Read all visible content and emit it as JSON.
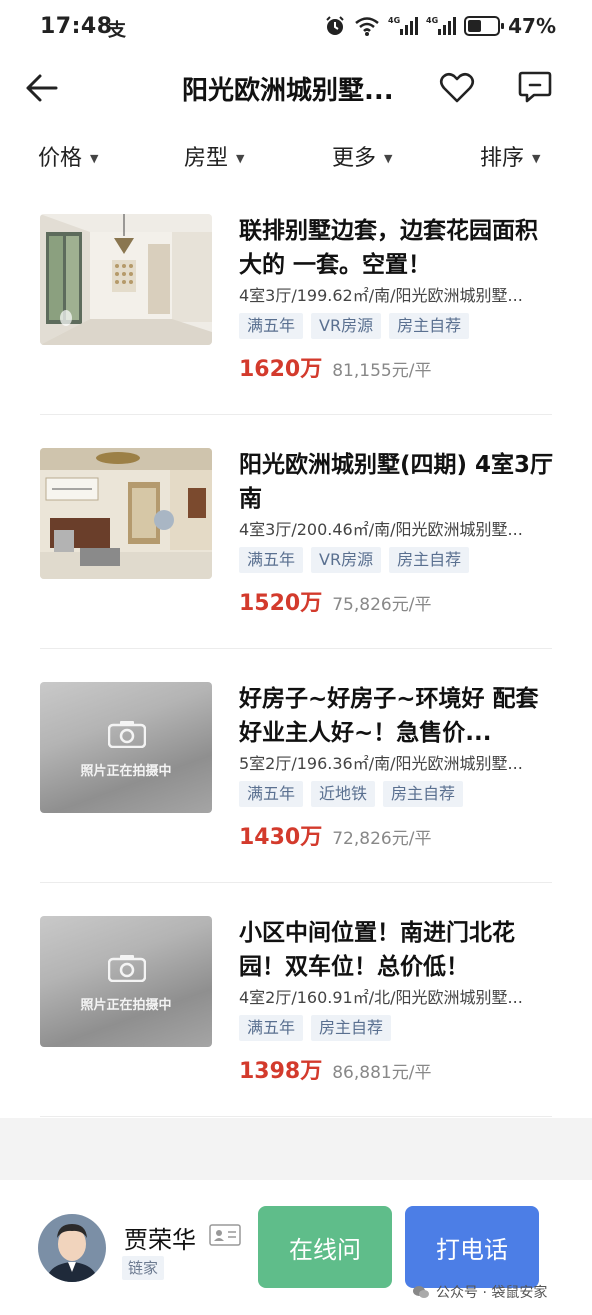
{
  "status_bar": {
    "time": "17:48",
    "battery_text": "47%",
    "battery_level": 0.47
  },
  "nav": {
    "title": "阳光欧洲城别墅..."
  },
  "filters": [
    {
      "label": "价格"
    },
    {
      "label": "房型"
    },
    {
      "label": "更多"
    },
    {
      "label": "排序"
    }
  ],
  "listings": [
    {
      "title": "联排别墅边套，边套花园面积大的 一套。空置！",
      "spec": "4室3厅/199.62㎡/南/阳光欧洲城别墅...",
      "tags": [
        "满五年",
        "VR房源",
        "房主自荐"
      ],
      "price": "1620万",
      "unit_price": "81,155元/平"
    },
    {
      "title": "阳光欧洲城别墅(四期) 4室3厅 南",
      "spec": "4室3厅/200.46㎡/南/阳光欧洲城别墅...",
      "tags": [
        "满五年",
        "VR房源",
        "房主自荐"
      ],
      "price": "1520万",
      "unit_price": "75,826元/平"
    },
    {
      "title": "好房子~好房子~环境好 配套好业主人好~！急售价...",
      "spec": "5室2厅/196.36㎡/南/阳光欧洲城别墅...",
      "tags": [
        "满五年",
        "近地铁",
        "房主自荐"
      ],
      "price": "1430万",
      "unit_price": "72,826元/平",
      "photo_placeholder": "照片正在拍摄中"
    },
    {
      "title": "小区中间位置！南进门北花园！双车位！总价低！",
      "spec": "4室2厅/160.91㎡/北/阳光欧洲城别墅...",
      "tags": [
        "满五年",
        "房主自荐"
      ],
      "price": "1398万",
      "unit_price": "86,881元/平",
      "photo_placeholder": "照片正在拍摄中"
    }
  ],
  "agent": {
    "name": "贾荣华",
    "company": "链家",
    "online_button": "在线问",
    "call_button": "打电话"
  },
  "watermark": "公众号 · 袋鼠安家",
  "colors": {
    "price_red": "#d33a2c",
    "online_green": "#5fbd8a",
    "call_blue": "#4c7ee6",
    "tag_bg": "#eef2f7"
  }
}
